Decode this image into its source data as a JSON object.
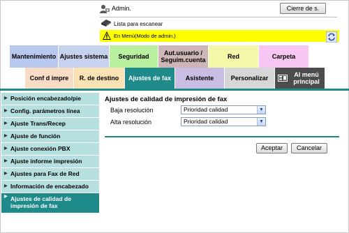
{
  "header": {
    "user_label": "Admin.",
    "logout_label": "Cierre de s.",
    "status_label": "Lista para escanear",
    "mode_banner": "En Menú(Modo de admin.)"
  },
  "tabs_row1": [
    {
      "label": "Mantenimiento",
      "color": "#b8c8ee"
    },
    {
      "label": "Ajustes sistema",
      "color": "#c6d2ee"
    },
    {
      "label": "Seguridad",
      "color": "#b8f0a0"
    },
    {
      "label": "Aut.usuario / Seguim.cuenta",
      "color": "#cfb6b6"
    },
    {
      "label": "Red",
      "color": "#f4f7a8"
    },
    {
      "label": "Carpeta",
      "color": "#f8c6f2"
    }
  ],
  "tabs_row2": [
    {
      "label": "Conf d impre",
      "color": "#f8dcc6"
    },
    {
      "label": "R. de destino",
      "color": "#fbe2b4"
    },
    {
      "label": "Ajustes de fax",
      "color": "#1f8a8a",
      "active": true
    },
    {
      "label": "Asistente",
      "color": "#c9bde3"
    },
    {
      "label": "Personalizar",
      "color": "#d6d6d6"
    },
    {
      "label": "Al menú principal",
      "color": "#4c4c4c"
    }
  ],
  "sidebar": {
    "items": [
      "Posición encabezado/pie",
      "Config. parámetros línea",
      "Ajuste Trans/Recep",
      "Ajuste de función",
      "Ajuste conexión PBX",
      "Ajuste informe impresión",
      "Ajustes para Fax de Red",
      "Información de encabezado",
      "Ajustes de calidad de impresión de fax"
    ],
    "active_index": 8
  },
  "main": {
    "title": "Ajustes de calidad de impresión de fax",
    "rows": [
      {
        "label": "Baja resolución",
        "value": "Prioridad calidad"
      },
      {
        "label": "Alta resolución",
        "value": "Prioridad calidad"
      }
    ],
    "accept_label": "Aceptar",
    "cancel_label": "Cancelar"
  },
  "colors": {
    "accent": "#1f8a8a",
    "sidebar_bg": "#b6e0e0",
    "banner_bg": "#ffff00"
  }
}
